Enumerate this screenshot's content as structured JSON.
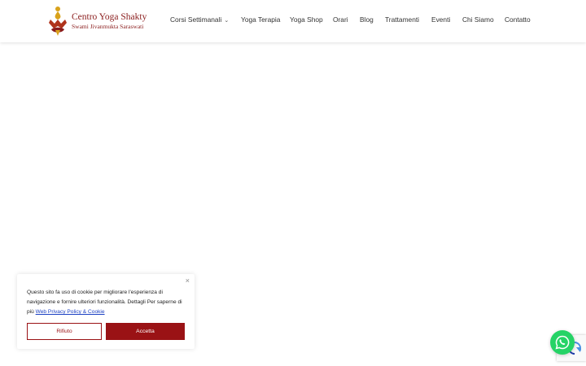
{
  "header": {
    "logo": {
      "title": "Centro Yoga Shakty",
      "subtitle": "Swami Jivanmukta Saraswati"
    },
    "nav": [
      {
        "label": "Corsi Settimanali",
        "has_dropdown": true
      },
      {
        "label": "Yoga Terapia"
      },
      {
        "label": "Yoga Shop"
      },
      {
        "label": "Orari"
      },
      {
        "label": "Blog"
      },
      {
        "label": "Trattamenti"
      },
      {
        "label": "Eventi"
      },
      {
        "label": "Chi Siamo"
      },
      {
        "label": "Contatto"
      }
    ]
  },
  "cookie_banner": {
    "close_icon": "close-icon",
    "text": "Questo sito fa uso di cookie per migliorare l'esperienza di navigazione e fornire ulteriori funzionalità. Dettagli Per saperne di più",
    "link_text": "Web Privacy Policy & Cookie",
    "reject_label": "Rifiuto",
    "accept_label": "Accetta",
    "accent_color": "#9a1215"
  },
  "floating": {
    "whatsapp_icon": "whatsapp-icon",
    "whatsapp_color": "#25d366",
    "recaptcha_icon": "recaptcha-icon"
  }
}
